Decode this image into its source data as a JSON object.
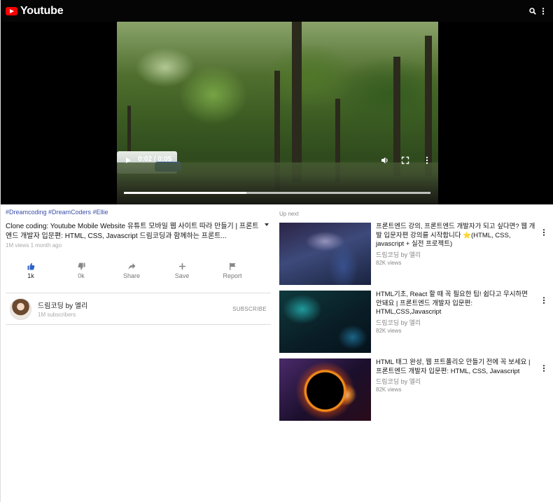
{
  "header": {
    "app_title": "Youtube",
    "icons": [
      "youtube-logo-icon",
      "search-icon",
      "more-vert-icon"
    ]
  },
  "player": {
    "time": "0:02 / 0:05",
    "progress_fraction": 0.4,
    "icons": [
      "play-icon",
      "volume-icon",
      "fullscreen-icon",
      "more-vert-icon"
    ]
  },
  "video": {
    "hashtags": "#Dreamcoding #DreamCoders #Ellie",
    "title": "Clone coding: Youtube Mobile Website 유튜트 모바일 웹 사이트 따라 만들기 | 프론트엔드 개발자 입문편: HTML, CSS, Javascript 드림코딩과 함께하는 프론트...",
    "meta": "1M views 1 month ago",
    "actions": [
      {
        "label": "1k",
        "icon": "thumb-up-icon"
      },
      {
        "label": "0k",
        "icon": "thumb-down-icon"
      },
      {
        "label": "Share",
        "icon": "share-icon"
      },
      {
        "label": "Save",
        "icon": "plus-icon"
      },
      {
        "label": "Report",
        "icon": "flag-icon"
      }
    ]
  },
  "channel": {
    "name": "드림코딩 by 엘리",
    "subscribers": "1M subscribers",
    "subscribe_label": "SUBSCRIBE"
  },
  "upnext": {
    "label": "Up next",
    "items": [
      {
        "title": "프론트엔드 강의, 프론트엔드 개발자가 되고 싶다면? 웹 개발 입문자편 강의를 시작합니다 ⭐(HTML, CSS, javascript + 실전 프로젝트)",
        "channel": "드림코딩 by 엘리",
        "views": "82K views"
      },
      {
        "title": "HTML기초, React 할 때 꼭 필요한 팁! 쉽다고 무시하면 안돼요 | 프론트엔드 개발자 입문편: HTML,CSS,Javascript",
        "channel": "드림코딩 by 엘리",
        "views": "82K views"
      },
      {
        "title": "HTML 태그 완성, 웹 프트폴리오 만들기 전에 꼭 보세요 | 프론트엔드 개발자 입문편: HTML, CSS, Javascript",
        "channel": "드림코딩 by 엘리",
        "views": "82K views"
      }
    ]
  }
}
